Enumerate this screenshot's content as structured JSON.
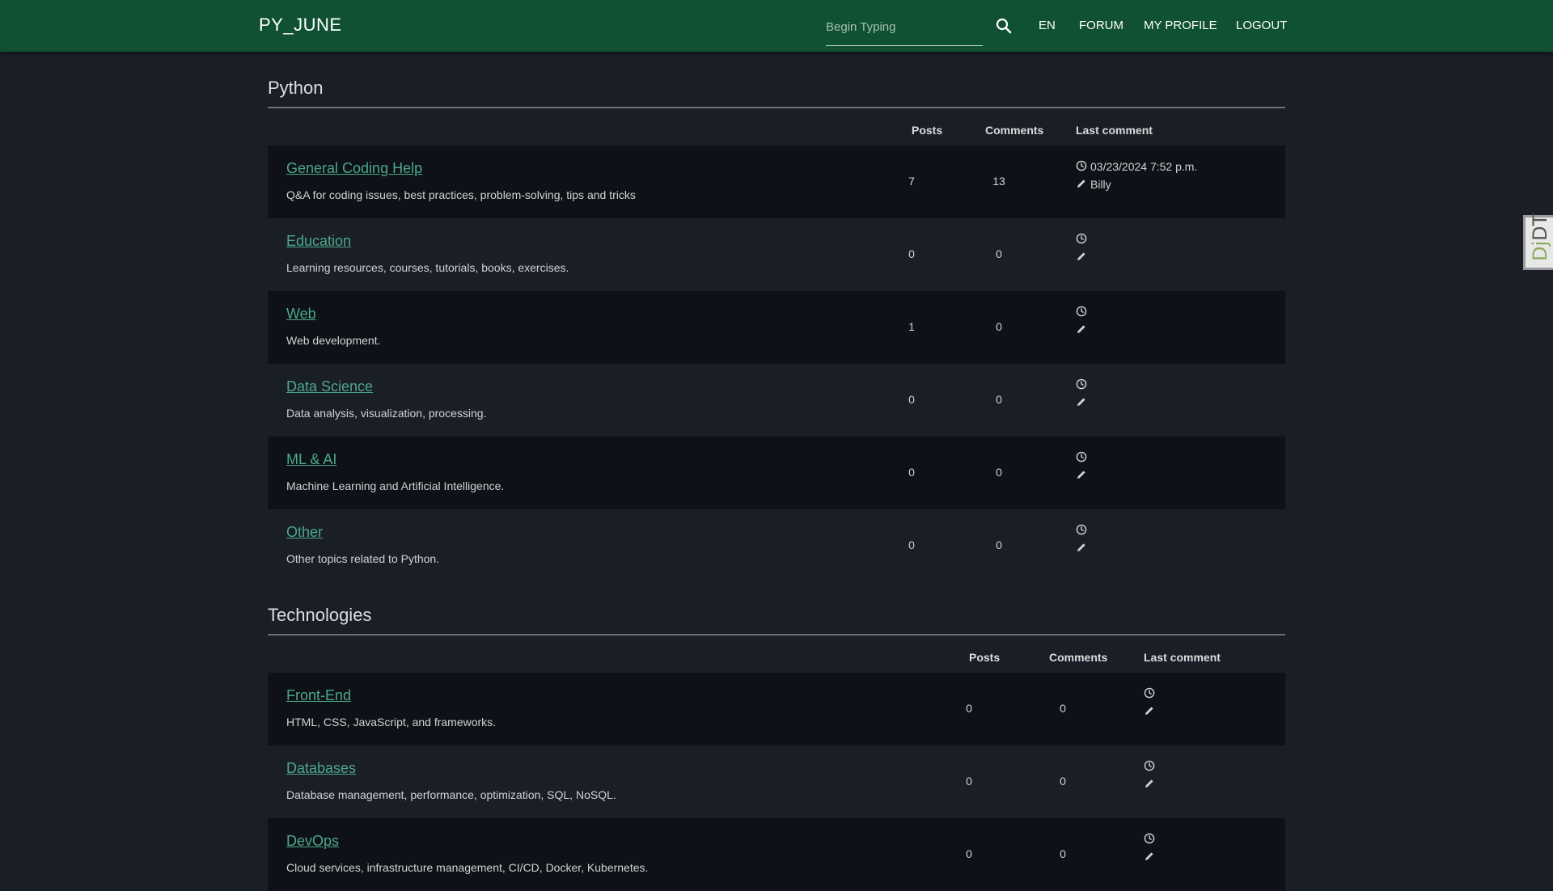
{
  "nav": {
    "brand": "PY_JUNE",
    "search_placeholder": "Begin Typing",
    "links": [
      "EN",
      "FORUM",
      "MY PROFILE",
      "LOGOUT"
    ]
  },
  "sections": [
    {
      "title": "Python",
      "headers": {
        "posts": "Posts",
        "comments": "Comments",
        "last": "Last comment"
      },
      "rows": [
        {
          "title": "General Coding Help",
          "desc": "Q&A for coding issues, best practices, problem-solving, tips and tricks",
          "posts": "7",
          "comments": "13",
          "last_date": "03/23/2024 7:52 p.m.",
          "last_user": "Billy"
        },
        {
          "title": "Education",
          "desc": "Learning resources, courses, tutorials, books, exercises.",
          "posts": "0",
          "comments": "0",
          "last_date": "",
          "last_user": ""
        },
        {
          "title": "Web",
          "desc": "Web development.",
          "posts": "1",
          "comments": "0",
          "last_date": "",
          "last_user": ""
        },
        {
          "title": "Data Science",
          "desc": "Data analysis, visualization, processing.",
          "posts": "0",
          "comments": "0",
          "last_date": "",
          "last_user": ""
        },
        {
          "title": "ML & AI",
          "desc": "Machine Learning and Artificial Intelligence.",
          "posts": "0",
          "comments": "0",
          "last_date": "",
          "last_user": ""
        },
        {
          "title": "Other",
          "desc": "Other topics related to Python.",
          "posts": "0",
          "comments": "0",
          "last_date": "",
          "last_user": ""
        }
      ]
    },
    {
      "title": "Technologies",
      "headers": {
        "posts": "Posts",
        "comments": "Comments",
        "last": "Last comment"
      },
      "rows": [
        {
          "title": "Front-End",
          "desc": "HTML, CSS, JavaScript, and frameworks.",
          "posts": "0",
          "comments": "0",
          "last_date": "",
          "last_user": ""
        },
        {
          "title": "Databases",
          "desc": "Database management, performance, optimization, SQL, NoSQL.",
          "posts": "0",
          "comments": "0",
          "last_date": "",
          "last_user": ""
        },
        {
          "title": "DevOps",
          "desc": "Cloud services, infrastructure management, CI/CD, Docker, Kubernetes.",
          "posts": "0",
          "comments": "0",
          "last_date": "",
          "last_user": ""
        }
      ]
    }
  ],
  "debug_toolbar": {
    "label_d": "D",
    "label_j": "j",
    "label_dt": "DT"
  },
  "colors": {
    "navbar": "#0f5132",
    "link": "#4ca88a",
    "row_dark": "#0e1117",
    "background": "#1a1e27"
  }
}
